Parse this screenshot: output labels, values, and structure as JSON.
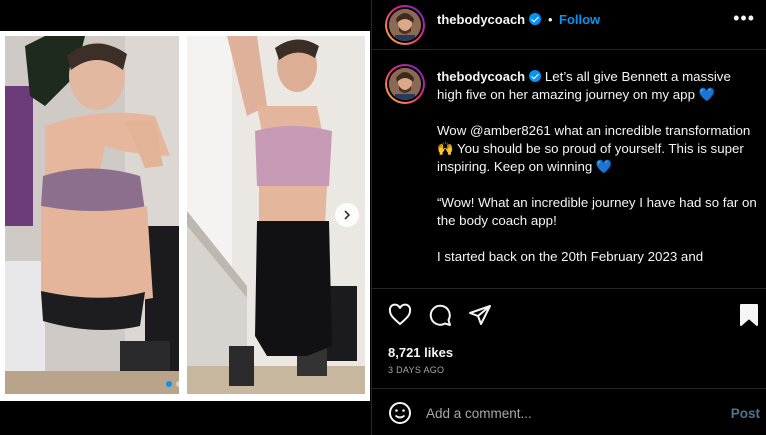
{
  "post": {
    "username": "thebodycoach",
    "follow_label": "Follow",
    "separator": "•",
    "more_label": "•••",
    "caption_username": "thebodycoach",
    "caption_paragraphs": [
      "Let’s all give Bennett a massive high five on her amazing journey on my app 💙",
      "Wow @amber8261 what an incredible transformation 🙌 You should be so proud of yourself. This is super inspiring. Keep on winning 💙",
      "“Wow! What an incredible journey I have had so far on the body coach app!",
      "I started back on the 20th February 2023 and"
    ],
    "likes": "8,721 likes",
    "time": "3 DAYS AGO"
  },
  "comment": {
    "placeholder": "Add a comment...",
    "post_label": "Post"
  },
  "carousel": {
    "slide_count": 2,
    "active_index": 0
  },
  "colors": {
    "accent": "#0095f6",
    "background": "#000000",
    "border": "#262626",
    "muted": "#a8a8a8"
  },
  "icons": [
    "heart-icon",
    "comment-icon",
    "share-icon",
    "bookmark-icon",
    "emoji-icon",
    "verified-icon",
    "chevron-right-icon"
  ]
}
